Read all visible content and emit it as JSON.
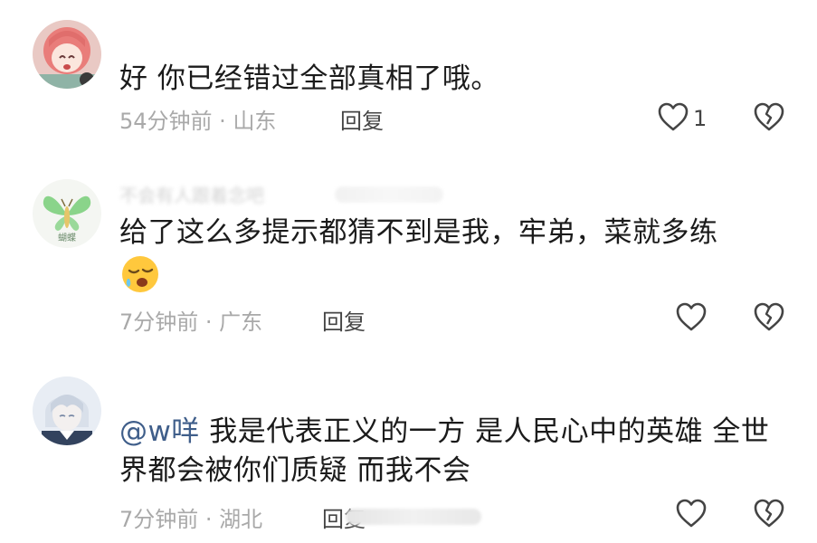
{
  "comments": [
    {
      "username": "",
      "text": "好 你已经错过全部真相了哦。",
      "time": "54分钟前",
      "location": "山东",
      "reply_label": "回复",
      "likes": "1"
    },
    {
      "username": "不会有人跟着念吧",
      "text": "给了这么多提示都猜不到是我，牢弟，菜就多练",
      "emoji": "sleepy-face-emoji",
      "avatar_text": "蝴蝶",
      "time": "7分钟前",
      "location": "广东",
      "reply_label": "回复",
      "likes": ""
    },
    {
      "mention": "@w咩",
      "text": "我是代表正义的一方 是人民心中的英雄 全世界都会被你们质疑 而我不会",
      "time": "7分钟前",
      "location": "湖北",
      "reply_label": "回复",
      "likes": ""
    }
  ],
  "separator": " · ",
  "icons": {
    "like": "heart-outline-icon",
    "dislike": "broken-heart-icon"
  },
  "colors": {
    "meta": "#a9a9a9",
    "mention": "#3f5e8a",
    "icon": "#444444"
  }
}
